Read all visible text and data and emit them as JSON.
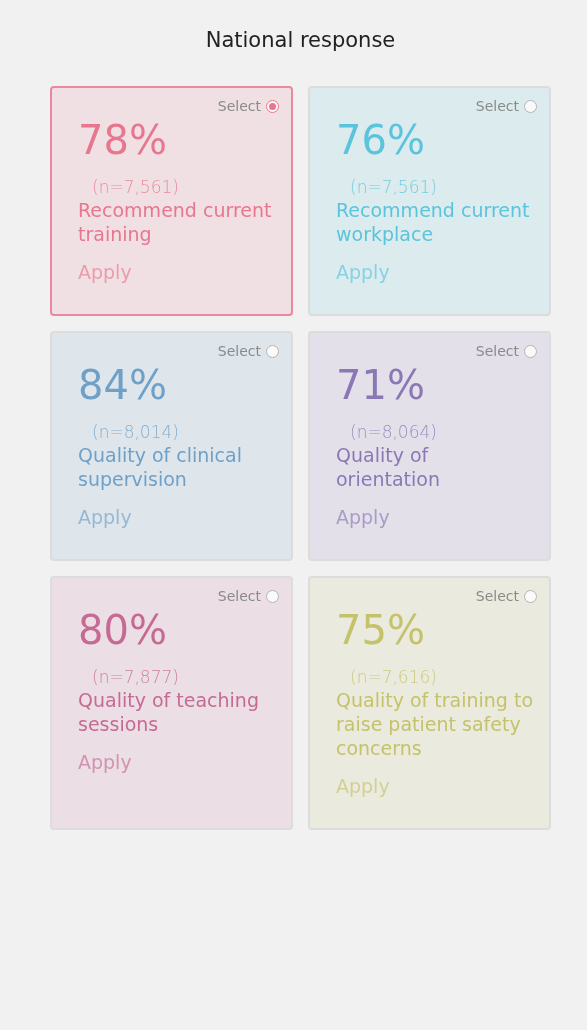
{
  "title": "National response",
  "cards": [
    {
      "percent": "78%",
      "count": "(n=7,561)",
      "label": "Recommend current training",
      "select": "Select",
      "apply": "Apply",
      "selected": true,
      "color": "#e8768f"
    },
    {
      "percent": "76%",
      "count": "(n=7,561)",
      "label": "Recommend current workplace",
      "select": "Select",
      "apply": "Apply",
      "selected": false,
      "color": "#5ac4dc"
    },
    {
      "percent": "84%",
      "count": "(n=8,014)",
      "label": "Quality of clinical supervision",
      "select": "Select",
      "apply": "Apply",
      "selected": false,
      "color": "#6fa0c8"
    },
    {
      "percent": "71%",
      "count": "(n=8,064)",
      "label": "Quality of orientation",
      "select": "Select",
      "apply": "Apply",
      "selected": false,
      "color": "#8a78b5"
    },
    {
      "percent": "80%",
      "count": "(n=7,877)",
      "label": "Quality of teaching sessions",
      "select": "Select",
      "apply": "Apply",
      "selected": false,
      "color": "#c66a94"
    },
    {
      "percent": "75%",
      "count": "(n=7,616)",
      "label": "Quality of training to raise patient safety concerns",
      "select": "Select",
      "apply": "Apply",
      "selected": false,
      "color": "#c4c26a"
    }
  ]
}
